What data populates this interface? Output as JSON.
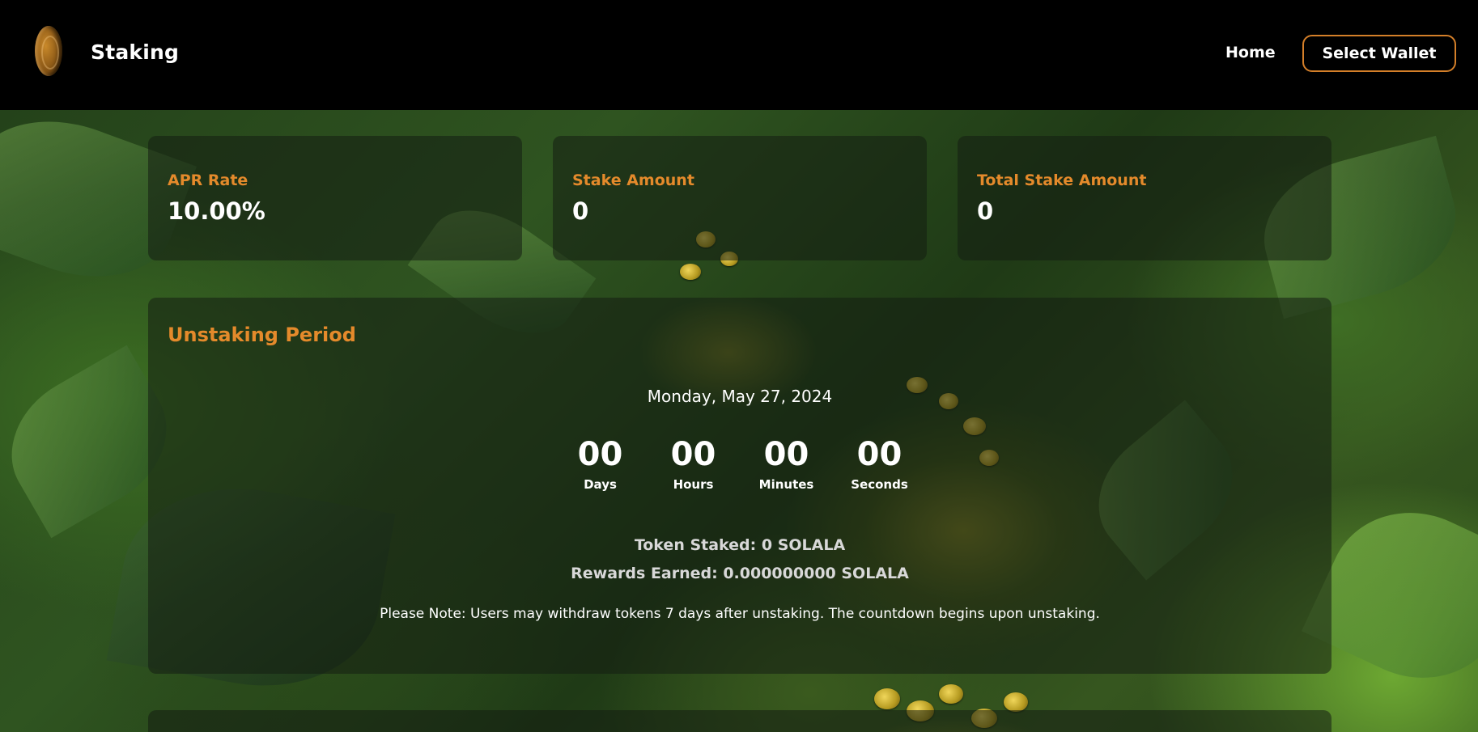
{
  "header": {
    "brand": "Staking",
    "nav_home": "Home",
    "wallet_button": "Select Wallet"
  },
  "stats": [
    {
      "label": "APR Rate",
      "value": "10.00%"
    },
    {
      "label": "Stake Amount",
      "value": "0"
    },
    {
      "label": "Total Stake Amount",
      "value": "0"
    }
  ],
  "unstaking": {
    "title": "Unstaking Period",
    "date": "Monday, May 27, 2024",
    "countdown": [
      {
        "value": "00",
        "label": "Days"
      },
      {
        "value": "00",
        "label": "Hours"
      },
      {
        "value": "00",
        "label": "Minutes"
      },
      {
        "value": "00",
        "label": "Seconds"
      }
    ],
    "token_staked": "Token Staked: 0 SOLALA",
    "rewards_earned": "Rewards Earned: 0.000000000 SOLALA",
    "note": "Please Note: Users may withdraw tokens 7 days after unstaking. The countdown begins upon unstaking."
  },
  "colors": {
    "accent": "#e48a2b",
    "wallet_border": "#d47f29",
    "header_bg": "#000000"
  }
}
